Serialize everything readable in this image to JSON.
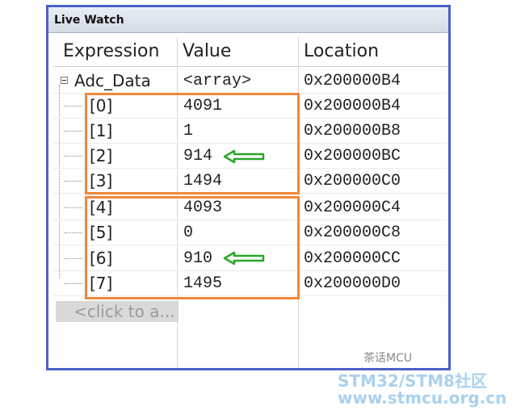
{
  "window": {
    "title": "Live Watch"
  },
  "columns": {
    "expression": "Expression",
    "value": "Value",
    "location": "Location"
  },
  "root": {
    "expression": "Adc_Data",
    "value": "<array>",
    "location": "0x200000B4"
  },
  "rows": [
    {
      "expression": "[0]",
      "value": "4091",
      "location": "0x200000B4"
    },
    {
      "expression": "[1]",
      "value": "1",
      "location": "0x200000B8"
    },
    {
      "expression": "[2]",
      "value": "914",
      "location": "0x200000BC"
    },
    {
      "expression": "[3]",
      "value": "1494",
      "location": "0x200000C0"
    },
    {
      "expression": "[4]",
      "value": "4093",
      "location": "0x200000C4"
    },
    {
      "expression": "[5]",
      "value": "0",
      "location": "0x200000C8"
    },
    {
      "expression": "[6]",
      "value": "910",
      "location": "0x200000CC"
    },
    {
      "expression": "[7]",
      "value": "1495",
      "location": "0x200000D0"
    }
  ],
  "add_row_placeholder": "<click to a...",
  "watermark": "茶话MCU",
  "footer": {
    "line1": "STM32/STM8社区",
    "line2": "www.stmcu.org.cn"
  },
  "colors": {
    "highlight_box": "#f0883a",
    "arrow": "#2aa52a",
    "window_border": "#4b5fc7"
  }
}
